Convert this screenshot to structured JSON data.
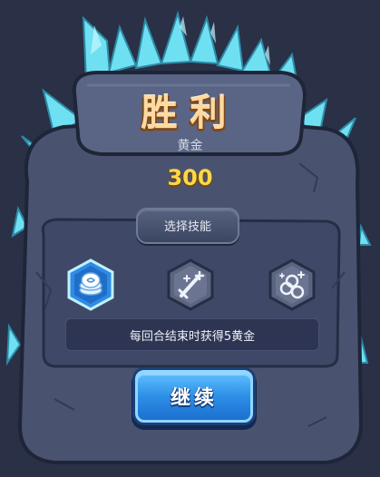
{
  "result": {
    "title": "胜利",
    "gold_label": "黄金",
    "gold_amount": "300"
  },
  "skills": {
    "header": "选择技能",
    "options": [
      {
        "icon": "coin-stack-icon",
        "selected": true
      },
      {
        "icon": "sword-sparkle-icon",
        "selected": false
      },
      {
        "icon": "coin-sparkle-icon",
        "selected": false
      }
    ],
    "description": "每回合结束时获得5黄金"
  },
  "actions": {
    "continue_label": "继续"
  },
  "colors": {
    "background": "#2a3046",
    "stone": "#4a5471",
    "crystal": "#6fe0f2",
    "gold_text": "#ffd64d",
    "title_text": "#ffd9a0",
    "selected_skill": "#2f8be3",
    "button": "#2d8fe6"
  }
}
